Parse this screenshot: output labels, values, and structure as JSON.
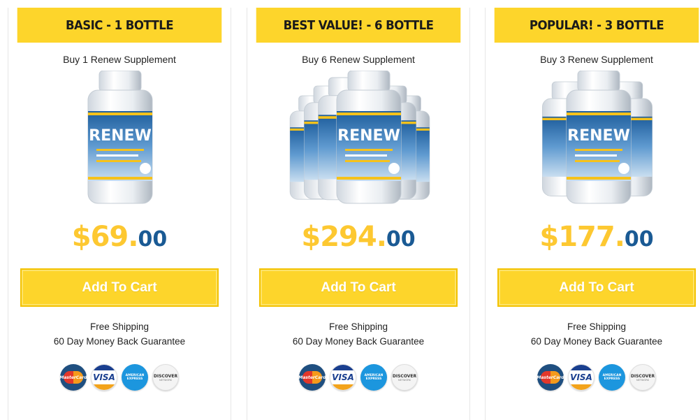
{
  "colors": {
    "header_bg": "#fdd52b",
    "price_dollars": "#fdc831",
    "price_cents": "#1a5a94",
    "cta_bg": "#fdd52b",
    "cta_text": "#ffffff"
  },
  "cards": [
    {
      "title": "BASIC - 1 BOTTLE",
      "subtitle": "Buy 1 Renew Supplement",
      "product_label": "RENEW",
      "price_dollars": "$69.",
      "price_cents": "00",
      "cta_label": "Add To Cart",
      "shipping": "Free Shipping",
      "guarantee": "60 Day Money Back Guarantee",
      "payment_icons": [
        "mastercard-icon",
        "visa-icon",
        "amex-icon",
        "discover-icon"
      ]
    },
    {
      "title": "BEST VALUE! - 6 BOTTLE",
      "subtitle": "Buy 6 Renew Supplement",
      "product_label": "RENEW",
      "price_dollars": "$294.",
      "price_cents": "00",
      "cta_label": "Add To Cart",
      "shipping": "Free Shipping",
      "guarantee": "60 Day Money Back Guarantee",
      "payment_icons": [
        "mastercard-icon",
        "visa-icon",
        "amex-icon",
        "discover-icon"
      ]
    },
    {
      "title": "POPULAR! - 3 BOTTLE",
      "subtitle": "Buy 3 Renew Supplement",
      "product_label": "RENEW",
      "price_dollars": "$177.",
      "price_cents": "00",
      "cta_label": "Add To Cart",
      "shipping": "Free Shipping",
      "guarantee": "60 Day Money Back Guarantee",
      "payment_icons": [
        "mastercard-icon",
        "visa-icon",
        "amex-icon",
        "discover-icon"
      ]
    }
  ],
  "payment_badges": {
    "mastercard": "MasterCard",
    "visa": "VISA",
    "amex": "AMERICAN EXPRESS",
    "discover": "DISCOVER",
    "discover_sub": "NETWORK"
  }
}
